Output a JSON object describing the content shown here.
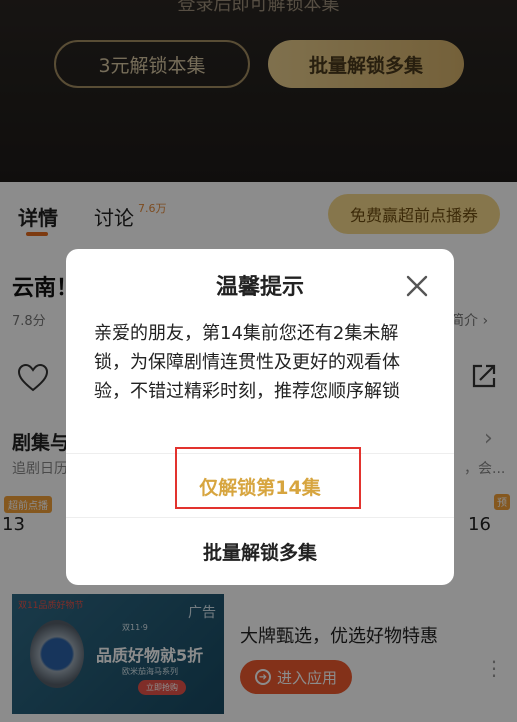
{
  "video": {
    "tip": "登录后即可解锁本集",
    "unlock_one_btn": "3元解锁本集",
    "batch_unlock_btn": "批量解锁多集"
  },
  "tabs": {
    "detail": "详情",
    "discuss": "讨论",
    "discuss_count": "7.6万",
    "free_btn": "免费赢超前点播券"
  },
  "content": {
    "title": "云南！",
    "score": "7.8分",
    "intro": "简介 ›",
    "episodes_title": "剧集与",
    "episodes_arrow": "›",
    "follow_text": "追剧日历",
    "follow_right": "，会...",
    "badge_left": "超前点播",
    "badge_right": "预",
    "ep_left": "13",
    "ep_right": "16"
  },
  "ad": {
    "label": "广告",
    "top_text": "双11品质好物节",
    "slogan": "品质好物就5折",
    "small_text": "双11·9",
    "small_text2": "欧米茄海马系列",
    "btn": "立即抢购",
    "headline": "大牌甄选，优选好物特惠",
    "cta": "进入应用",
    "more": "⋮"
  },
  "modal": {
    "title": "温馨提示",
    "body": "亲爱的朋友，第14集前您还有2集未解锁，为保障剧情连贯性及更好的观看体验，不错过精彩时刻，推荐您顺序解锁",
    "unlock_only_btn": "仅解锁第14集",
    "batch_btn": "批量解锁多集"
  },
  "colors": {
    "accent_gold": "#d7a53f",
    "highlight_red": "#e2332e",
    "tab_accent": "#e36a1e",
    "cta_orange": "#ef5a2f"
  }
}
